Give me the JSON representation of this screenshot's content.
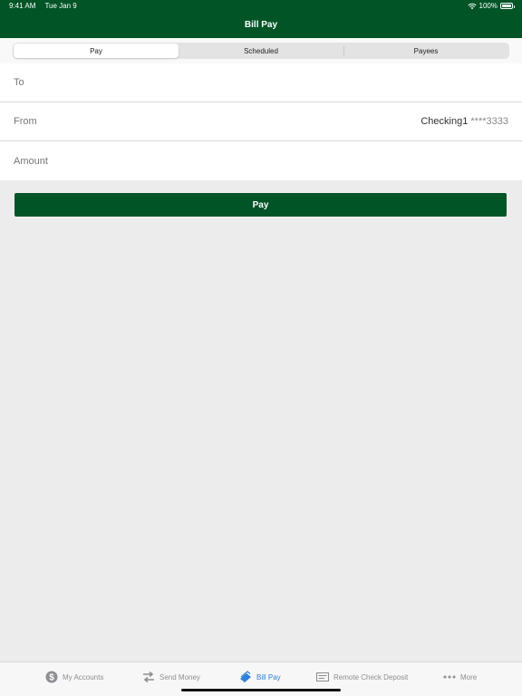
{
  "status_bar": {
    "time": "9:41 AM",
    "date": "Tue Jan 9",
    "battery": "100%"
  },
  "header": {
    "title": "Bill Pay"
  },
  "segments": [
    {
      "label": "Pay",
      "active": true
    },
    {
      "label": "Scheduled",
      "active": false
    },
    {
      "label": "Payees",
      "active": false
    }
  ],
  "form": {
    "to_label": "To",
    "from_label": "From",
    "from_account": "Checking1",
    "from_mask": "****3333",
    "amount_label": "Amount"
  },
  "pay_button": {
    "label": "Pay"
  },
  "tabs": [
    {
      "label": "My Accounts",
      "icon": "dollar-circle-icon",
      "active": false
    },
    {
      "label": "Send Money",
      "icon": "transfer-arrows-icon",
      "active": false
    },
    {
      "label": "Bill Pay",
      "icon": "bill-pay-icon",
      "active": true
    },
    {
      "label": "Remote Check Deposit",
      "icon": "check-deposit-icon",
      "active": false
    },
    {
      "label": "More",
      "icon": "more-dots-icon",
      "active": false
    }
  ],
  "colors": {
    "brand": "#005426",
    "accent": "#2f7fd6",
    "background": "#ececec"
  }
}
